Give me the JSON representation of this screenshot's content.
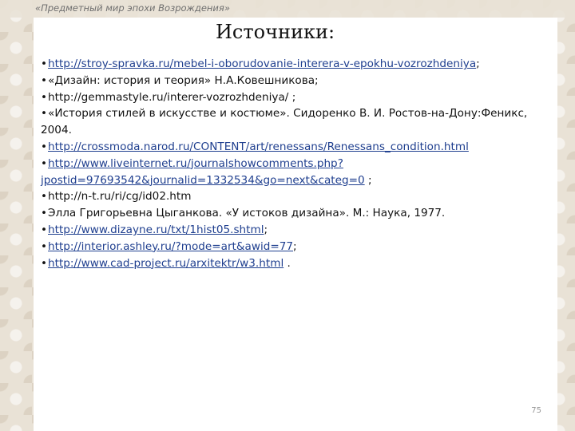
{
  "header": {
    "caption": "«Предметный мир эпохи Возрождения»"
  },
  "slide": {
    "title": "Источники:",
    "bullet": "•",
    "page_number": "75"
  },
  "sources": [
    {
      "text": "",
      "link": "http://stroy-spravka.ru/mebel-i-oborudovanie-interera-v-epokhu-vozrozhdeniya",
      "suffix": ";"
    },
    {
      "text": "«Дизайн: история и теория» Н.А.Ковешникова;",
      "link": "",
      "suffix": ""
    },
    {
      "text": "http://gemmastyle.ru/interer-vozrozhdeniya/ ;",
      "link": "",
      "suffix": ""
    },
    {
      "text": "«История стилей в искусстве и костюме». Сидоренко В. И. Ростов-на-Дону:Феникс, 2004.",
      "link": "",
      "suffix": ""
    },
    {
      "text": "",
      "link": "http://crossmoda.narod.ru/CONTENT/art/renessans/Renessans_condition.html",
      "suffix": ""
    },
    {
      "text": "",
      "link": "http://www.liveinternet.ru/journalshowcomments.php?jpostid=97693542&journalid=1332534&go=next&categ=0",
      "suffix": " ;"
    },
    {
      "text": "http://n-t.ru/ri/cg/id02.htm",
      "link": "",
      "suffix": ""
    },
    {
      "text": "Элла Григорьевна Цыганкова. «У истоков дизайна». М.: Наука, 1977.",
      "link": "",
      "suffix": ""
    },
    {
      "text": "",
      "link": "http://www.dizayne.ru/txt/1hist05.shtml",
      "suffix": ";"
    },
    {
      "text": "",
      "link": "http://interior.ashley.ru/?mode=art&awid=77",
      "suffix": ";"
    },
    {
      "text": "",
      "link": "http://www.cad-project.ru/arxitektr/w3.html",
      "suffix": " ."
    }
  ]
}
